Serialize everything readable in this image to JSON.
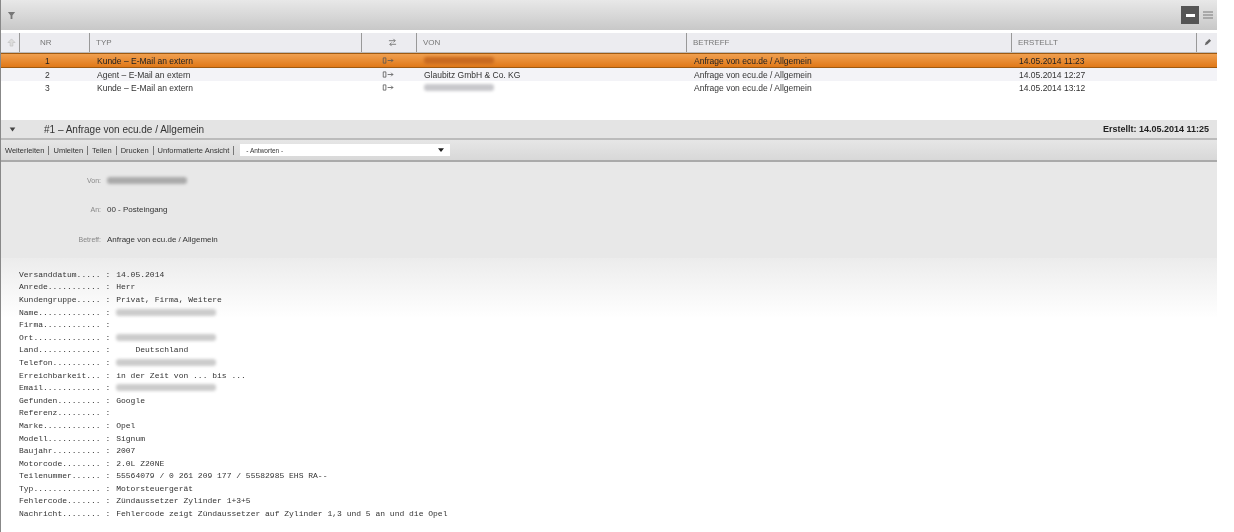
{
  "table": {
    "columns": [
      {
        "kind": "icon"
      },
      {
        "kind": "text",
        "label": "NR"
      },
      {
        "kind": "text",
        "label": "TYP"
      },
      {
        "kind": "icon"
      },
      {
        "kind": "text",
        "label": "VON"
      },
      {
        "kind": "text",
        "label": "BETREFF"
      },
      {
        "kind": "text",
        "label": "ERSTELLT"
      },
      {
        "kind": "icon"
      }
    ],
    "rows": [
      {
        "nr": "1",
        "typ": "Kunde – E-Mail an extern",
        "von_redacted": true,
        "betreff": "Anfrage von ecu.de / Allgemein",
        "erstellt": "14.05.2014 11:23",
        "selected": true
      },
      {
        "nr": "2",
        "typ": "Agent – E-Mail an extern",
        "von": "Glaubitz GmbH & Co. KG",
        "betreff": "Anfrage von ecu.de / Allgemein",
        "erstellt": "14.05.2014 12:27",
        "selected": false
      },
      {
        "nr": "3",
        "typ": "Kunde – E-Mail an extern",
        "von_redacted": true,
        "betreff": "Anfrage von ecu.de / Allgemein",
        "erstellt": "14.05.2014 13:12",
        "selected": false
      }
    ]
  },
  "detail": {
    "title": "#1 – Anfrage von ecu.de / Allgemein",
    "created": "Erstellt: 14.05.2014 11:25",
    "actions": [
      "Weiterleiten",
      "Umleiten",
      "Teilen",
      "Drucken",
      "Unformatierte Ansicht"
    ],
    "reply_select": "- Antworten -",
    "meta": [
      {
        "label": "Von:",
        "redacted": true
      },
      {
        "label": "An:",
        "value": "00 - Posteingang"
      },
      {
        "label": "Betreff:",
        "value": "Anfrage von ecu.de / Allgemein"
      }
    ],
    "body": [
      {
        "key": "Versanddatum..... :",
        "value": "14.05.2014"
      },
      {
        "key": "Anrede........... :",
        "value": "Herr"
      },
      {
        "key": "Kundengruppe..... :",
        "value": "Privat, Firma, Weitere"
      },
      {
        "key": "Name............. :",
        "redacted": true
      },
      {
        "key": "Firma............ :"
      },
      {
        "key": "Ort.............. :",
        "redacted": true
      },
      {
        "key": "Land............. :",
        "value": "    Deutschland"
      },
      {
        "key": "Telefon.......... :",
        "redacted": true
      },
      {
        "key": "Erreichbarkeit... :",
        "value": "in der Zeit von ... bis ..."
      },
      {
        "key": "Email............ :",
        "redacted": true
      },
      {
        "key": "Gefunden......... :",
        "value": "Google"
      },
      {
        "key": "Referenz......... :"
      },
      {
        "key": "Marke............ :",
        "value": "Opel"
      },
      {
        "key": "Modell........... :",
        "value": "Signum"
      },
      {
        "key": "Baujahr.......... :",
        "value": "2007"
      },
      {
        "key": "Motorcode........ :",
        "value": "2.0L Z20NE"
      },
      {
        "key": "Teilenummer...... :",
        "value": "55564079 / 0 261 209 177 / 55582985 EHS RA--"
      },
      {
        "key": "Typ.............. :",
        "value": "Motorsteuergerät"
      },
      {
        "key": "Fehlercode....... :",
        "value": "Zündaussetzer Zylinder 1+3+5"
      },
      {
        "key": "Nachricht........ :",
        "value": "Fehlercode zeigt Zündaussetzer auf Zylinder 1,3 und 5 an und die Opel"
      }
    ]
  }
}
